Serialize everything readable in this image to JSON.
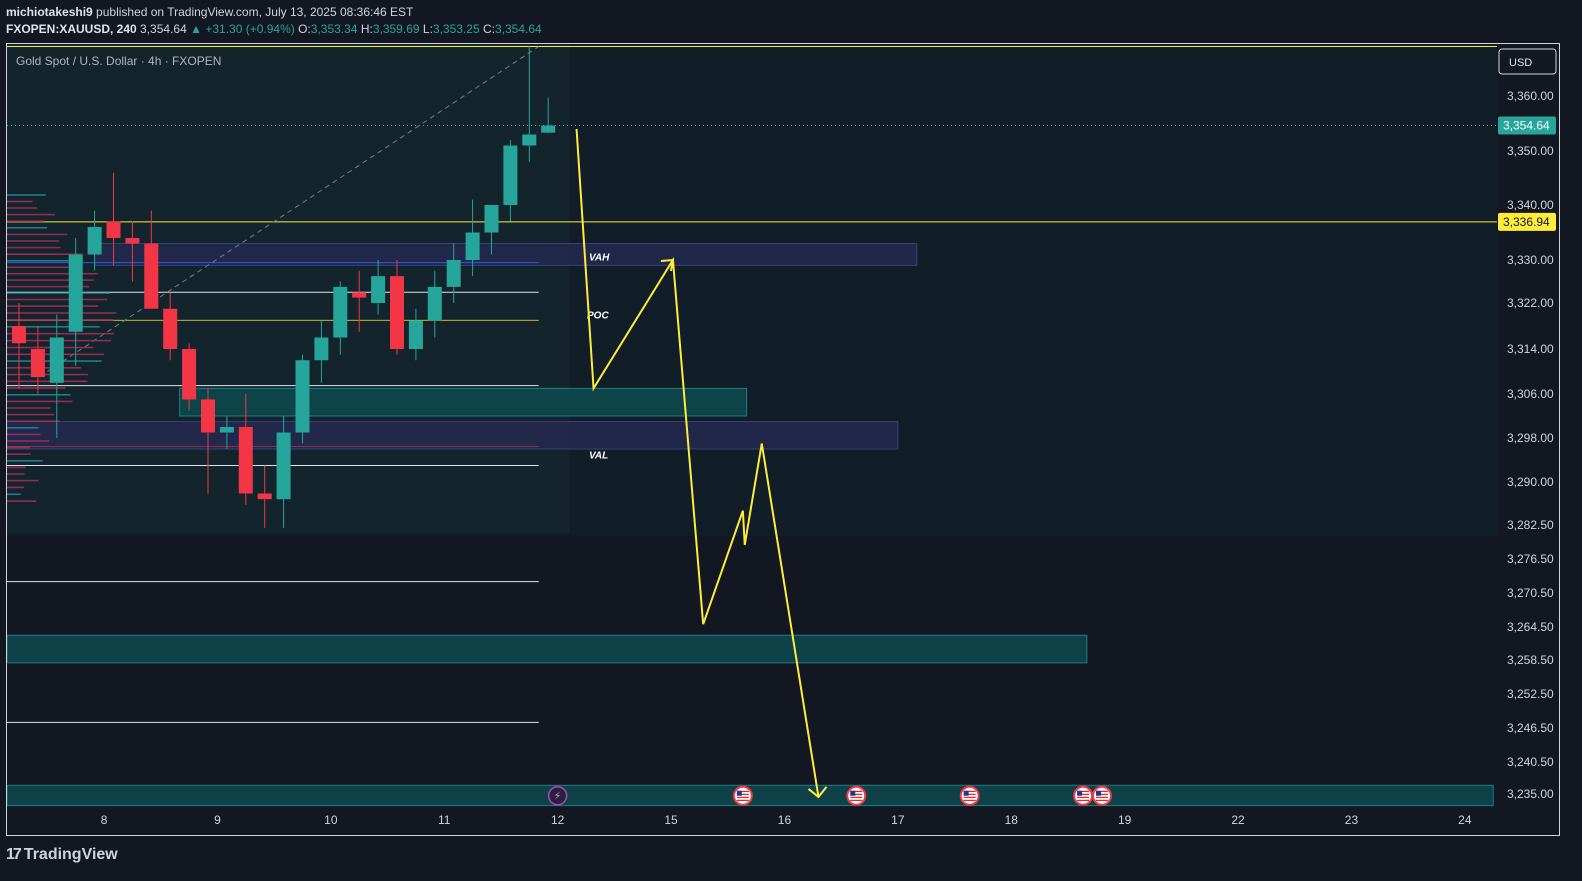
{
  "header": {
    "author": "michiotakeshi9",
    "published_text": "published on TradingView.com, July 13, 2025 08:36:46 EST",
    "symbol": "FXOPEN:XAUUSD, 240",
    "last": "3,354.64",
    "change_arrow": "▲",
    "change": "+31.30 (+0.94%)",
    "o_label": "O:",
    "o": "3,353.34",
    "h_label": "H:",
    "h": "3,359.69",
    "l_label": "L:",
    "l": "3,353.25",
    "c_label": "C:",
    "c": "3,354.64"
  },
  "footer": {
    "brand": "TradingView",
    "logo_glyph": "17"
  },
  "chart_data": {
    "type": "candlestick",
    "title": "Gold Spot / U.S. Dollar · 4h · FXOPEN",
    "currency": "USD",
    "colors": {
      "up": "#26a69a",
      "down": "#f23645",
      "annotation": "#ffeb3b",
      "background": "#131722",
      "zone_teal": "#0e4a4f",
      "zone_blue": "#25294f"
    },
    "x_ticks": [
      {
        "label": "8",
        "i": 4.5
      },
      {
        "label": "9",
        "i": 10.5
      },
      {
        "label": "10",
        "i": 16.5
      },
      {
        "label": "11",
        "i": 22.5
      },
      {
        "label": "12",
        "i": 28.5
      },
      {
        "label": "15",
        "i": 34.5
      },
      {
        "label": "16",
        "i": 40.5
      },
      {
        "label": "17",
        "i": 46.5
      },
      {
        "label": "18",
        "i": 52.5
      },
      {
        "label": "19",
        "i": 58.5
      },
      {
        "label": "22",
        "i": 64.5
      },
      {
        "label": "23",
        "i": 70.5
      },
      {
        "label": "24",
        "i": 76.5
      }
    ],
    "y_ticks": [
      "3,360.00",
      "3,350.00",
      "3,340.00",
      "3,330.00",
      "3,322.00",
      "3,314.00",
      "3,306.00",
      "3,298.00",
      "3,290.00",
      "3,282.50",
      "3,276.50",
      "3,270.50",
      "3,264.50",
      "3,258.50",
      "3,252.50",
      "3,246.50",
      "3,240.50",
      "3,235.00"
    ],
    "y_tick_values": [
      3360,
      3350,
      3340,
      3330,
      3322,
      3314,
      3306,
      3298,
      3290,
      3282.5,
      3276.5,
      3270.5,
      3264.5,
      3258.5,
      3252.5,
      3246.5,
      3240.5,
      3235
    ],
    "last_price": {
      "value": 3354.64,
      "label": "3,354.64"
    },
    "level": {
      "value": 3336.94,
      "label": "3,336.94"
    },
    "candles": [
      {
        "o": 3318,
        "h": 3322,
        "l": 3307,
        "c": 3315
      },
      {
        "o": 3314,
        "h": 3318,
        "l": 3306,
        "c": 3309
      },
      {
        "o": 3308,
        "h": 3320,
        "l": 3298,
        "c": 3316
      },
      {
        "o": 3317,
        "h": 3334,
        "l": 3311,
        "c": 3331
      },
      {
        "o": 3331,
        "h": 3339,
        "l": 3328,
        "c": 3336
      },
      {
        "o": 3337,
        "h": 3346,
        "l": 3329,
        "c": 3334
      },
      {
        "o": 3334,
        "h": 3337,
        "l": 3326,
        "c": 3333
      },
      {
        "o": 3333,
        "h": 3339,
        "l": 3324,
        "c": 3321
      },
      {
        "o": 3321,
        "h": 3324,
        "l": 3312,
        "c": 3314
      },
      {
        "o": 3314,
        "h": 3315,
        "l": 3303,
        "c": 3305
      },
      {
        "o": 3305,
        "h": 3307,
        "l": 3288,
        "c": 3299
      },
      {
        "o": 3299,
        "h": 3302,
        "l": 3296,
        "c": 3300
      },
      {
        "o": 3300,
        "h": 3306,
        "l": 3286,
        "c": 3288
      },
      {
        "o": 3288,
        "h": 3293,
        "l": 3282,
        "c": 3287
      },
      {
        "o": 3287,
        "h": 3302,
        "l": 3282,
        "c": 3299
      },
      {
        "o": 3299,
        "h": 3313,
        "l": 3297,
        "c": 3312
      },
      {
        "o": 3312,
        "h": 3319,
        "l": 3308,
        "c": 3316
      },
      {
        "o": 3316,
        "h": 3326,
        "l": 3313,
        "c": 3325
      },
      {
        "o": 3324,
        "h": 3328,
        "l": 3317,
        "c": 3323
      },
      {
        "o": 3322,
        "h": 3330,
        "l": 3320,
        "c": 3327
      },
      {
        "o": 3327,
        "h": 3330,
        "l": 3313,
        "c": 3314
      },
      {
        "o": 3314,
        "h": 3321,
        "l": 3312,
        "c": 3319
      },
      {
        "o": 3319,
        "h": 3328,
        "l": 3316,
        "c": 3325
      },
      {
        "o": 3325,
        "h": 3333,
        "l": 3322,
        "c": 3330
      },
      {
        "o": 3330,
        "h": 3341,
        "l": 3327,
        "c": 3335
      },
      {
        "o": 3335,
        "h": 3340,
        "l": 3331,
        "c": 3340
      },
      {
        "o": 3340,
        "h": 3352,
        "l": 3337,
        "c": 3351
      },
      {
        "o": 3351,
        "h": 3369,
        "l": 3348,
        "c": 3353
      },
      {
        "o": 3353.34,
        "h": 3359.69,
        "l": 3353.25,
        "c": 3354.64
      }
    ],
    "zones": [
      {
        "kind": "blue",
        "i0": 4,
        "i1": 47.5,
        "top": 3333,
        "bottom": 3329
      },
      {
        "kind": "teal",
        "i0": 8.5,
        "i1": 38.5,
        "top": 3307,
        "bottom": 3302
      },
      {
        "kind": "blue",
        "i0": 0,
        "i1": 46.5,
        "top": 3301,
        "bottom": 3296
      },
      {
        "kind": "teal",
        "i0": 0,
        "i1": 56.5,
        "top": 3263,
        "bottom": 3258
      },
      {
        "kind": "teal",
        "i0": 0,
        "i1": 78,
        "top": 3236.5,
        "bottom": 3233
      }
    ],
    "profile_levels": [
      {
        "name": "VAH",
        "value": 3329.5,
        "label": "VAH"
      },
      {
        "name": "POC",
        "value": 3319,
        "label": "POC"
      },
      {
        "name": "VAL",
        "value": 3296.5,
        "label": "VAL"
      }
    ],
    "white_lines": [
      3324,
      3307.5,
      3293,
      3272.5,
      3247.5
    ],
    "projection_path": [
      {
        "i": 29.5,
        "v": 3354
      },
      {
        "i": 30.4,
        "v": 3307
      },
      {
        "i": 34.6,
        "v": 3330
      },
      {
        "i": 36.2,
        "v": 3265
      },
      {
        "i": 38.3,
        "v": 3285
      },
      {
        "i": 38.4,
        "v": 3279
      },
      {
        "i": 39.3,
        "v": 3297
      },
      {
        "i": 42.3,
        "v": 3234.5
      }
    ],
    "event_markers": [
      {
        "kind": "lightning",
        "i": 28.5
      },
      {
        "kind": "us-flag",
        "i": 38.3
      },
      {
        "kind": "us-flag",
        "i": 44.3
      },
      {
        "kind": "us-flag",
        "i": 50.3
      },
      {
        "kind": "us-flag",
        "i": 56.3
      },
      {
        "kind": "us-flag",
        "i": 57.3
      }
    ]
  }
}
